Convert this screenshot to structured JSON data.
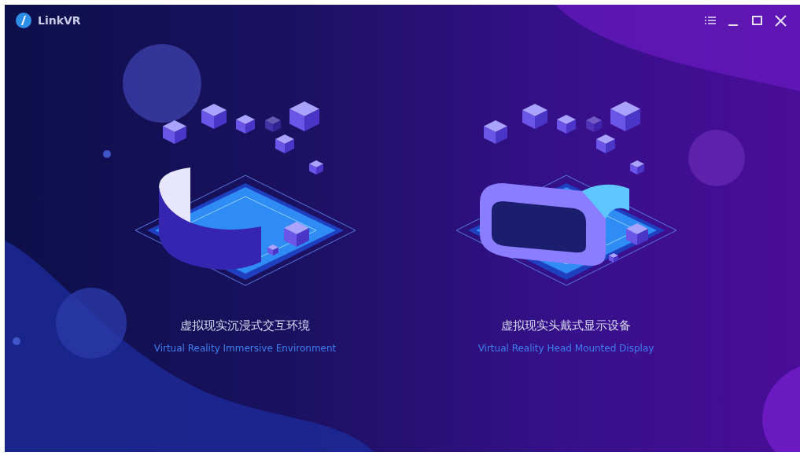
{
  "app": {
    "title": "LinkVR"
  },
  "window_controls": [
    {
      "kind": "menu"
    },
    {
      "kind": "minimize"
    },
    {
      "kind": "maximize"
    },
    {
      "kind": "close"
    }
  ],
  "options": [
    {
      "kind": "immersive",
      "title": "虚拟现实沉浸式交互环境",
      "subtitle": "Virtual Reality Immersive Environment"
    },
    {
      "kind": "headset",
      "title": "虚拟现实头戴式显示设备",
      "subtitle": "Virtual Reality Head Mounted Display"
    }
  ]
}
